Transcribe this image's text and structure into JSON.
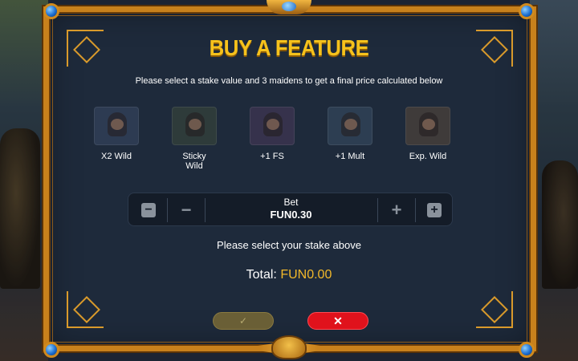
{
  "title": "BUY A FEATURE",
  "subtitle": "Please select a stake value and 3 maidens to get a final price calculated below",
  "features": [
    {
      "label": "X2 Wild",
      "color": "#3a4a66"
    },
    {
      "label": "Sticky Wild",
      "color": "#3c4a3a"
    },
    {
      "label": "+1 FS",
      "color": "#4a3a5a"
    },
    {
      "label": "+1 Mult",
      "color": "#3a5066"
    },
    {
      "label": "Exp. Wild",
      "color": "#5a4a3a"
    }
  ],
  "bet": {
    "label": "Bet",
    "value": "FUN0.30",
    "min_icon": "minus-square-icon",
    "dec_icon": "minus-icon",
    "inc_icon": "plus-icon",
    "max_icon": "plus-square-icon"
  },
  "message": "Please select your stake above",
  "total": {
    "label": "Total:",
    "amount": "FUN0.00"
  },
  "buttons": {
    "confirm_icon": "check-icon",
    "cancel_icon": "close-icon"
  },
  "colors": {
    "accent_gold": "#f6c21c",
    "frame": "#c8811c",
    "cancel": "#e0121c",
    "confirm_disabled": "#6a5f36",
    "panel": "#1e2a3b"
  }
}
